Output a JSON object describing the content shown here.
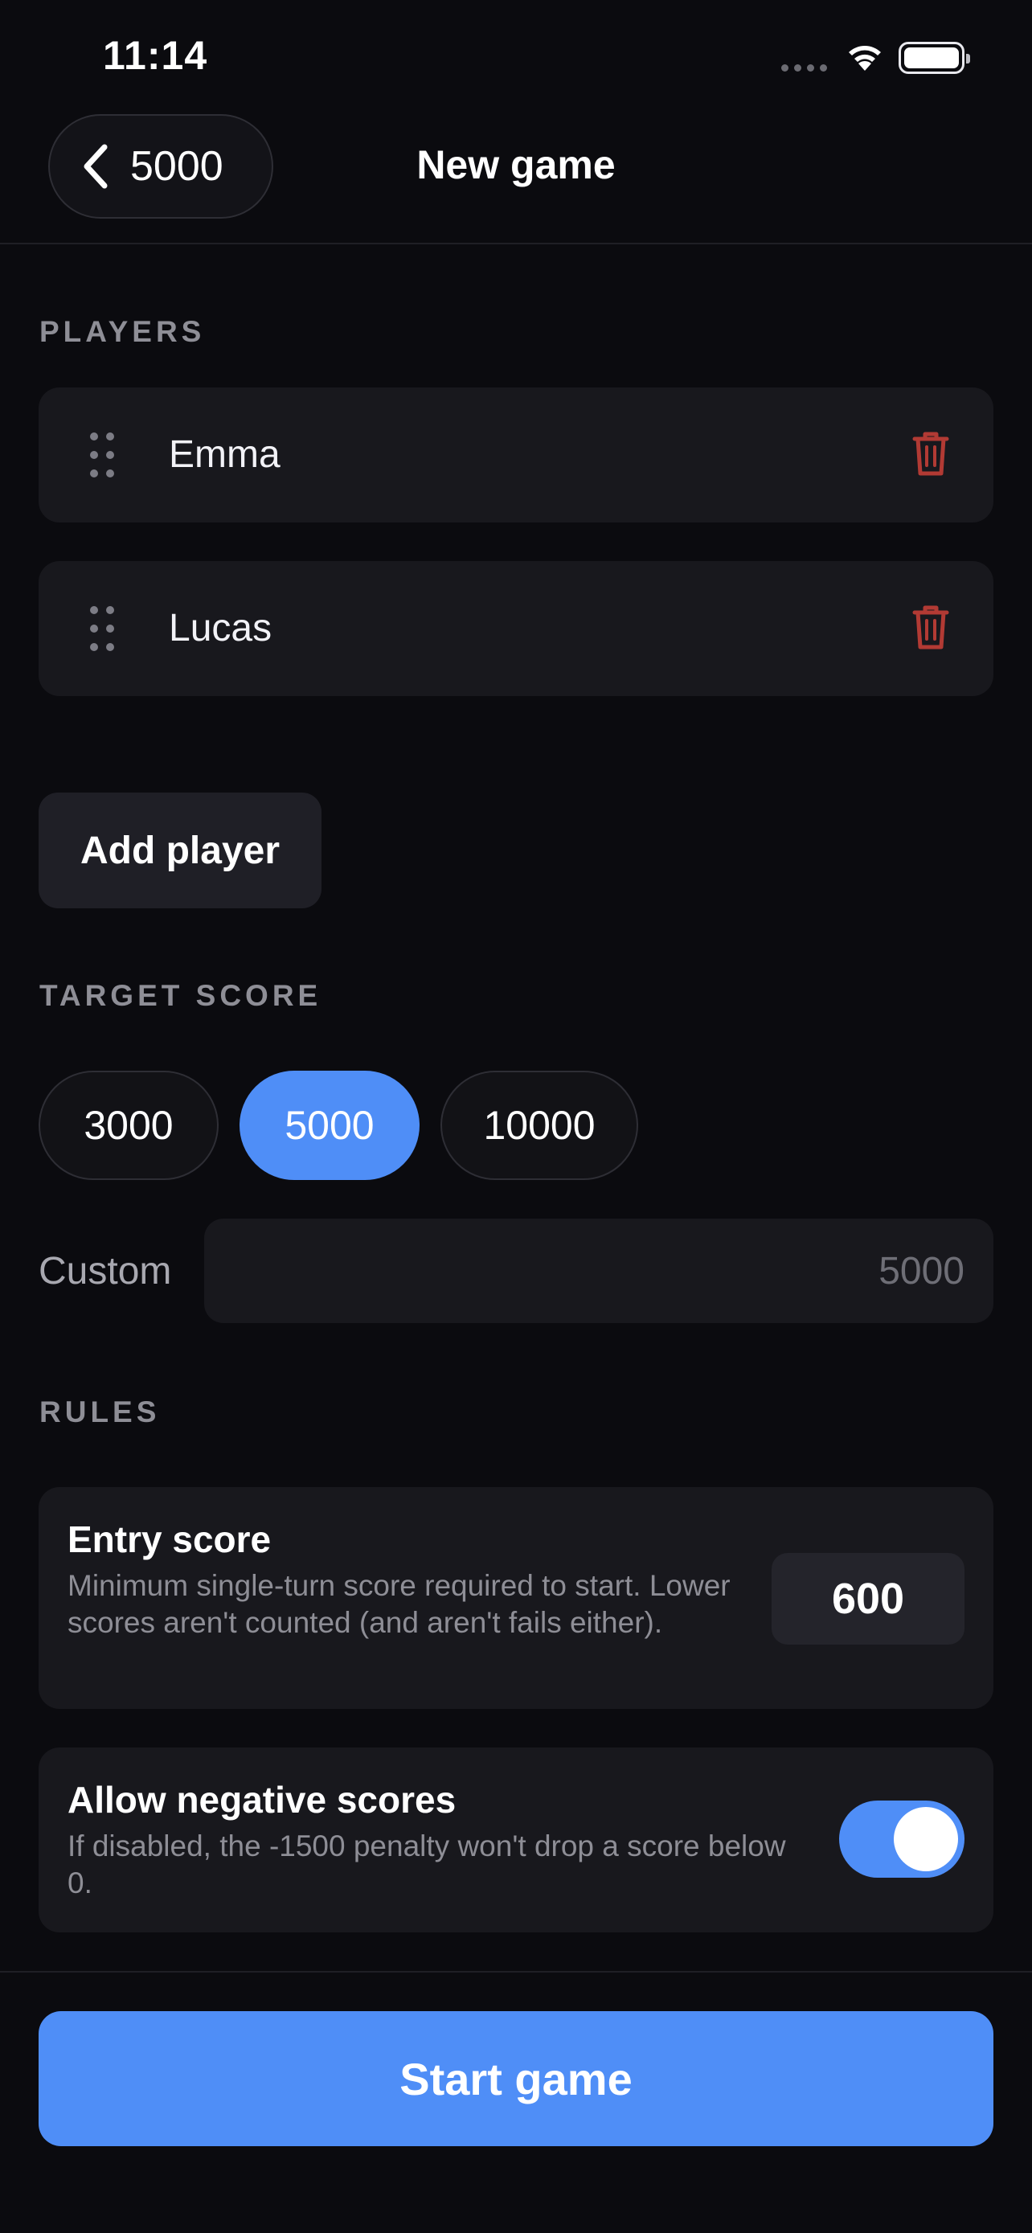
{
  "status_bar": {
    "time": "11:14"
  },
  "nav": {
    "back_label": "5000",
    "title": "New game"
  },
  "players": {
    "header": "PLAYERS",
    "items": [
      {
        "name": "Emma"
      },
      {
        "name": "Lucas"
      }
    ],
    "add_label": "Add player"
  },
  "target": {
    "header": "TARGET SCORE",
    "options": [
      "3000",
      "5000",
      "10000"
    ],
    "selected": "5000",
    "custom_label": "Custom",
    "custom_placeholder": "5000"
  },
  "rules": {
    "header": "RULES",
    "entry": {
      "title": "Entry score",
      "description": "Minimum single-turn score required to start. Lower scores aren't counted (and aren't fails either).",
      "value": "600"
    },
    "negative": {
      "title": "Allow negative scores",
      "description": "If disabled, the -1500 penalty won't drop a score below 0.",
      "enabled": true
    }
  },
  "start_label": "Start game",
  "colors": {
    "accent": "#4f8ef7",
    "danger": "#c0392b",
    "background": "#0b0b0f",
    "card": "#18181d"
  }
}
